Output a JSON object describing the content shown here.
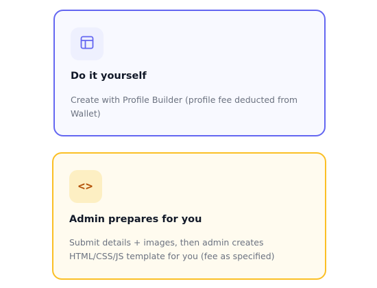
{
  "options": [
    {
      "id": "diy",
      "title": "Do it yourself",
      "description": "Create with Profile Builder (profile fee deducted from Wallet)",
      "icon": "layout-icon",
      "border_color": "#6366f1",
      "background": "#f8f9ff",
      "icon_bg": "#eef0fe",
      "icon_color": "#6366f1"
    },
    {
      "id": "admin",
      "title": "Admin prepares for you",
      "description": "Submit details + images, then admin creates HTML/CSS/JS template for you (fee as specified)",
      "icon": "code-icon",
      "icon_glyph": "<>",
      "border_color": "#fbbf24",
      "background": "#fffbef",
      "icon_bg": "#fdefc3",
      "icon_color": "#b45309"
    }
  ]
}
